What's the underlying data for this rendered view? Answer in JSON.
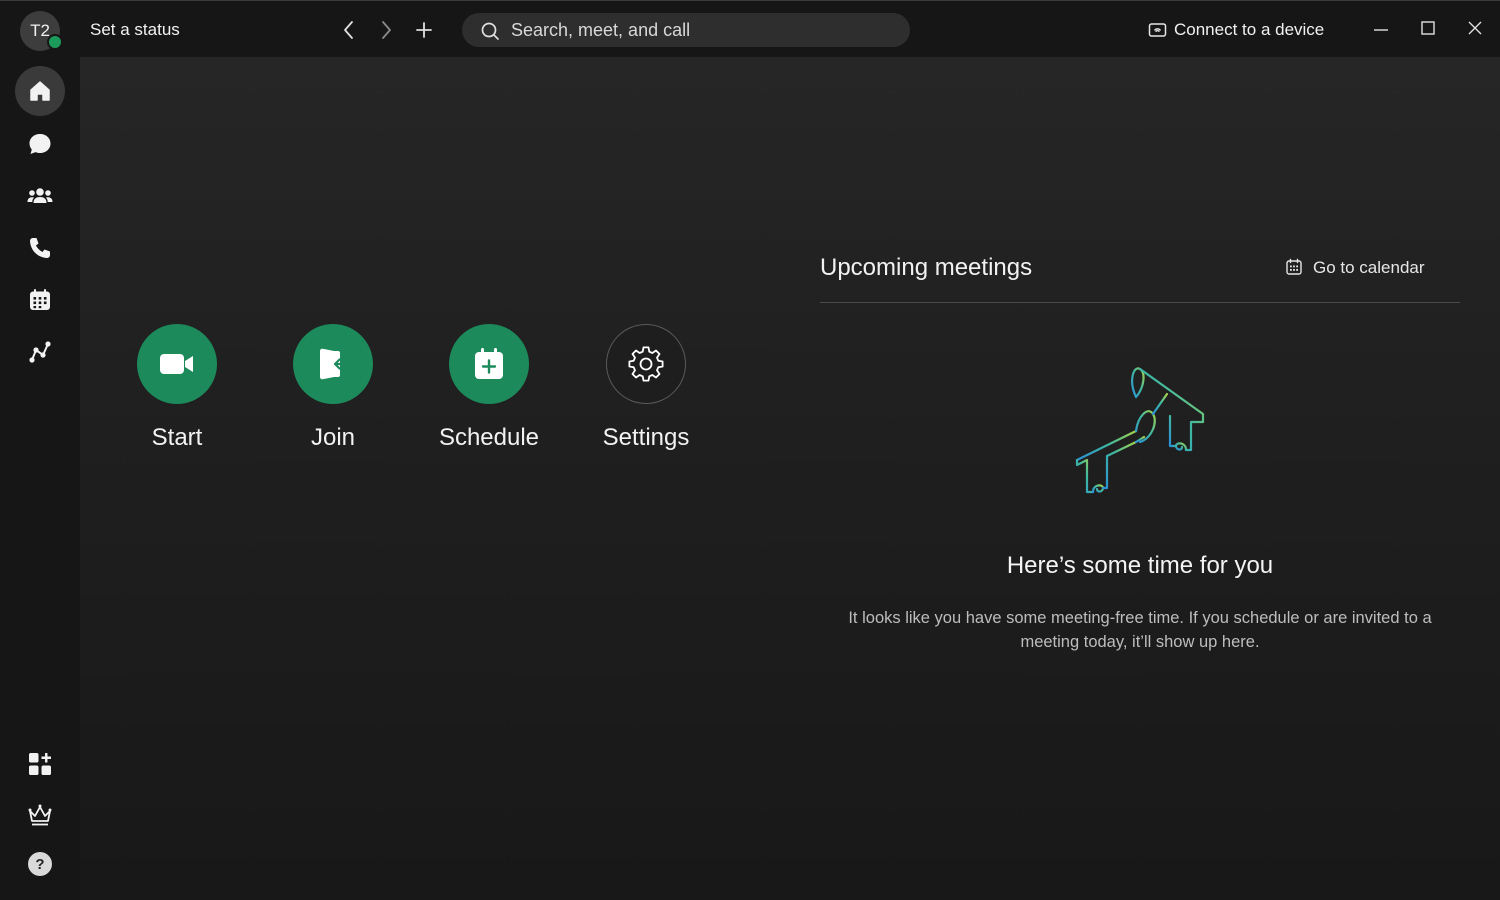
{
  "titlebar": {
    "avatar_initials": "T2",
    "status_text": "Set a status",
    "search_placeholder": "Search, meet, and call",
    "connect_label": "Connect to a device"
  },
  "sidebar": {
    "items": [
      {
        "icon": "home-icon",
        "active": true
      },
      {
        "icon": "messaging-icon"
      },
      {
        "icon": "teams-icon"
      },
      {
        "icon": "calling-icon"
      },
      {
        "icon": "calendar-icon"
      },
      {
        "icon": "analytics-icon"
      }
    ],
    "bottom_items": [
      {
        "icon": "apps-add-icon"
      },
      {
        "icon": "crown-icon"
      },
      {
        "icon": "help-icon"
      }
    ]
  },
  "actions": [
    {
      "label": "Start",
      "icon": "video-icon"
    },
    {
      "label": "Join",
      "icon": "join-icon"
    },
    {
      "label": "Schedule",
      "icon": "calendar-add-icon"
    },
    {
      "label": "Settings",
      "icon": "gear-icon"
    }
  ],
  "upcoming": {
    "title": "Upcoming meetings",
    "go_to_calendar": "Go to calendar",
    "empty_title": "Here’s some time for you",
    "empty_description": "It looks like you have some meeting-free time. If you schedule or are invited to a meeting today, it’ll show up here."
  },
  "colors": {
    "accent_green": "#1c8a5a",
    "presence_green": "#1c9a5b",
    "background": "#181818"
  }
}
